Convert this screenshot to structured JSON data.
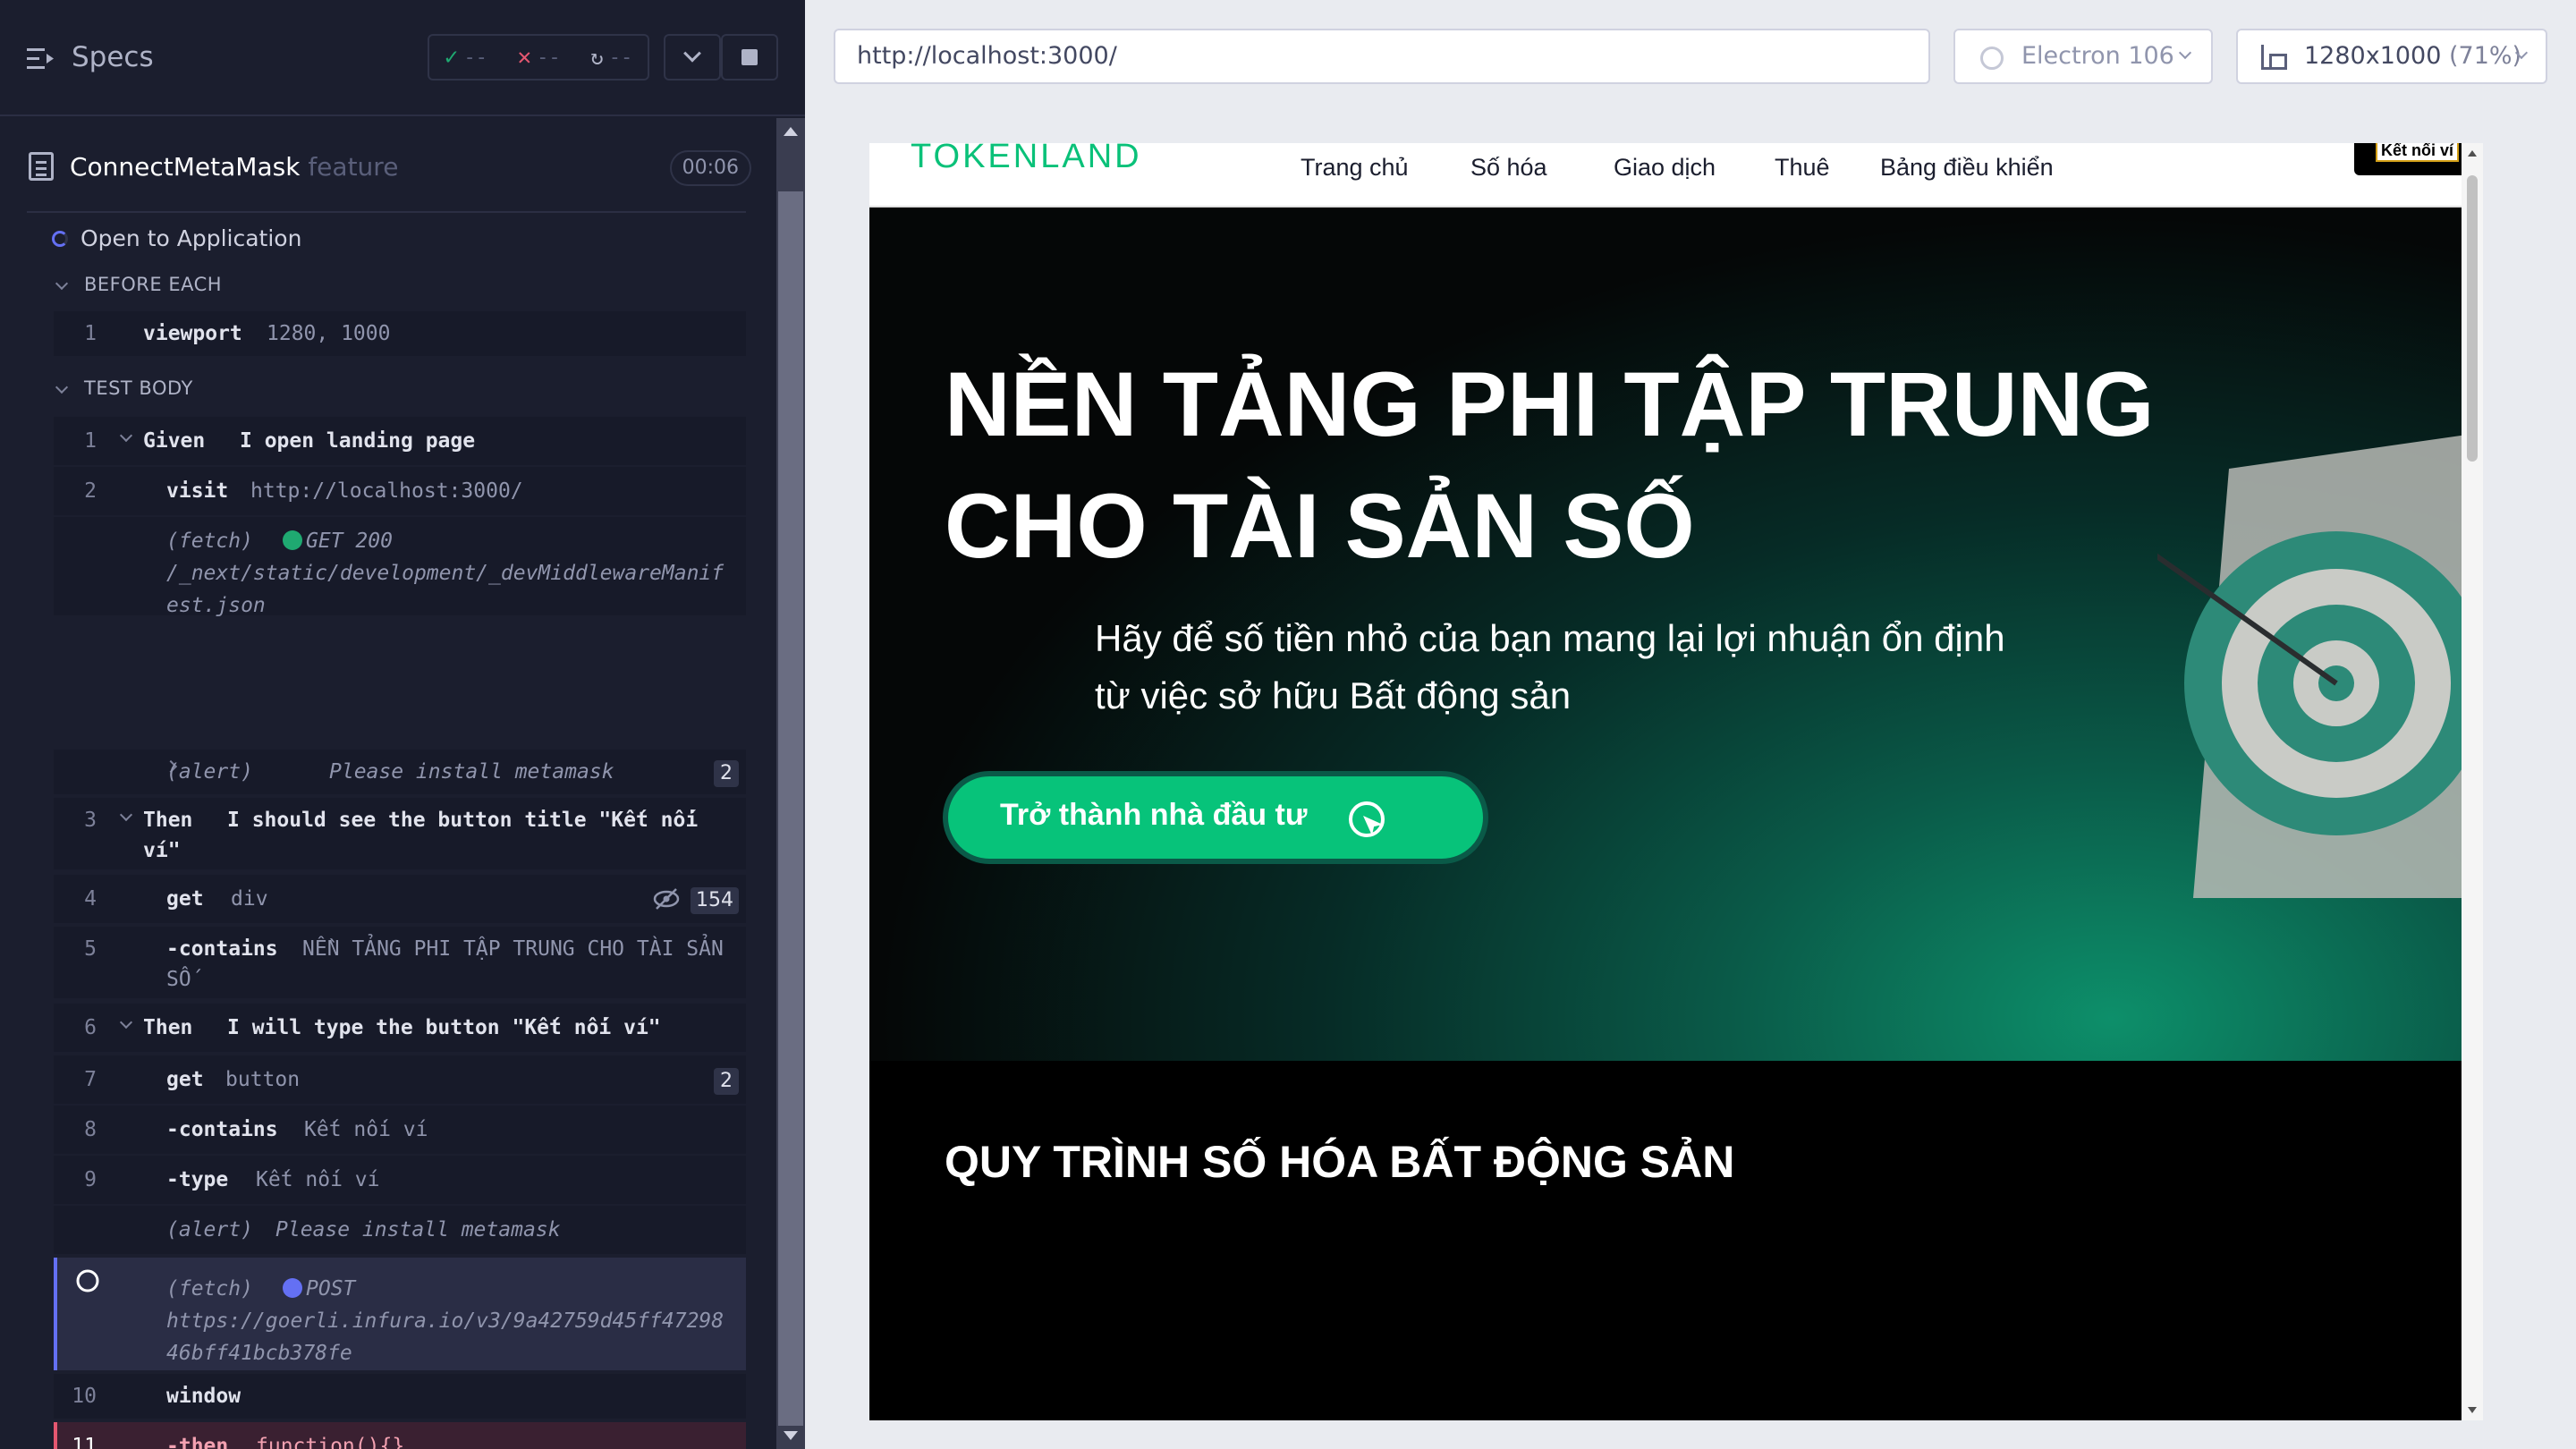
{
  "runner": {
    "specs_label": "Specs",
    "stats": {
      "passed": "--",
      "failed": "--",
      "pending": "--"
    },
    "spec": {
      "name": "ConnectMetaMask",
      "ext": "feature",
      "duration": "00:06"
    },
    "test_title": "Open to Application",
    "sections": {
      "before_each": "BEFORE EACH",
      "test_body": "TEST BODY"
    },
    "before_each": [
      {
        "num": "1",
        "name": "viewport",
        "msg": "1280, 1000"
      }
    ],
    "commands": [
      {
        "num": "1",
        "name": "Given",
        "msg": "I open landing page"
      },
      {
        "num": "2",
        "name": "visit",
        "msg": "http://localhost:3000/"
      },
      {
        "num": "",
        "name": "(fetch)",
        "method": "GET 200",
        "msg1": "/_next/static/development/_devMiddlewareManif",
        "msg2": "est.json"
      },
      {
        "num": "",
        "name": "(alert)",
        "msg": "Please install metamask",
        "badge": "2"
      },
      {
        "num": "3",
        "name": "Then",
        "msg1": "I should see the button title \"Kết nối",
        "msg2": "ví\""
      },
      {
        "num": "4",
        "name": "get",
        "msg": "div",
        "badge": "154"
      },
      {
        "num": "5",
        "name": "-contains",
        "msg1": "NỀN TẢNG PHI TẬP TRUNG CHO TÀI SẢN",
        "msg2": "SỐ"
      },
      {
        "num": "6",
        "name": "Then",
        "msg": "I will type the button \"Kết nối ví\""
      },
      {
        "num": "7",
        "name": "get",
        "msg": "button",
        "badge": "2"
      },
      {
        "num": "8",
        "name": "-contains",
        "msg": "Kết nối ví"
      },
      {
        "num": "9",
        "name": "-type",
        "msg": "Kết nối ví"
      },
      {
        "num": "",
        "name": "(alert)",
        "msg": "Please install metamask"
      },
      {
        "num": "",
        "name": "(fetch)",
        "method": "POST",
        "msg1": "https://goerli.infura.io/v3/9a42759d45ff47298",
        "msg2": "46bff41bcb378fe"
      },
      {
        "num": "10",
        "name": "window",
        "msg": ""
      },
      {
        "num": "11",
        "name": "-then",
        "msg": "function(){}"
      }
    ]
  },
  "aut": {
    "url": "http://localhost:3000/",
    "browser": "Electron 106",
    "viewport": "1280x1000",
    "scale": "(71%)"
  },
  "site": {
    "logo": "TOKENLAND",
    "nav": [
      "Trang chủ",
      "Số hóa",
      "Giao dịch",
      "Thuê",
      "Bảng điều khiển"
    ],
    "connect_button": "Kết nối ví",
    "hero_title_line1": "NỀN TẢNG PHI TẬP TRUNG",
    "hero_title_line2": "CHO TÀI SẢN SỐ",
    "hero_sub_line1": "Hãy để số tiền nhỏ của bạn mang lại lợi nhuận ổn định",
    "hero_sub_line2": "từ việc sở hữu Bất động sản",
    "cta": "Trở thành nhà đầu tư",
    "process_title": "QUY TRÌNH SỐ HÓA BẤT ĐỘNG SẢN"
  },
  "colors": {
    "runner_bg": "#1b1e2e",
    "active_accent": "#6470f3",
    "failed_accent": "#e45770",
    "brand_green": "#07c37a"
  }
}
